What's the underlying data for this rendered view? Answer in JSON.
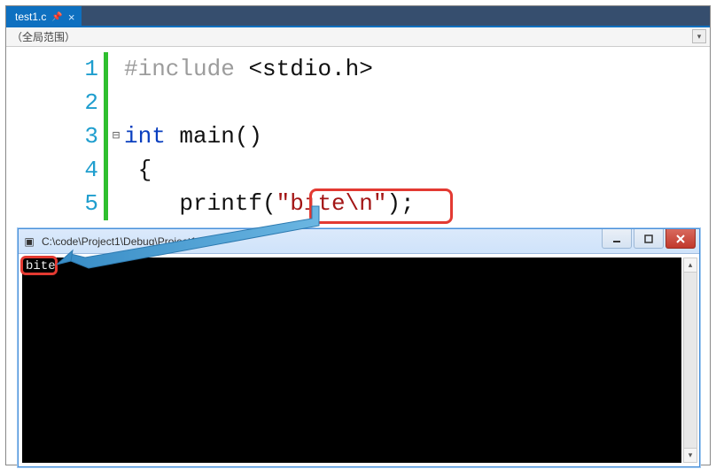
{
  "editor": {
    "tab": {
      "filename": "test1.c"
    },
    "scope_label": "（全局范围）",
    "lines": [
      {
        "num": 1,
        "fold": "",
        "tokens": [
          [
            "preproc",
            "#include "
          ],
          [
            "angle",
            "<"
          ],
          [
            "txt",
            "stdio.h"
          ],
          [
            "angle",
            ">"
          ]
        ]
      },
      {
        "num": 2,
        "fold": "",
        "tokens": []
      },
      {
        "num": 3,
        "fold": "⊟",
        "tokens": [
          [
            "kw",
            "int"
          ],
          [
            "txt",
            " main"
          ],
          [
            "paren",
            "()"
          ]
        ]
      },
      {
        "num": 4,
        "fold": "",
        "tokens": [
          [
            "txt",
            " {"
          ]
        ]
      },
      {
        "num": 5,
        "fold": "",
        "tokens": [
          [
            "txt",
            "    printf"
          ],
          [
            "paren",
            "("
          ],
          [
            "str",
            "\"bite\\n\""
          ],
          [
            "paren",
            ")"
          ],
          [
            "txt",
            ";"
          ]
        ]
      }
    ]
  },
  "console": {
    "title_path": "C:\\code\\Project1\\Debug\\Project1.exe",
    "output": "bite"
  }
}
